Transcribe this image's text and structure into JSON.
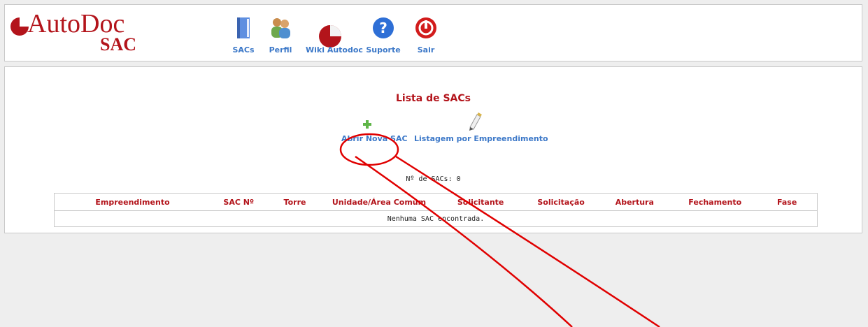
{
  "header": {
    "logo": {
      "brand": "AutoDoc",
      "sub": "SAC"
    },
    "nav": [
      {
        "label": "SACs",
        "icon": "book-icon"
      },
      {
        "label": "Perfil",
        "icon": "users-icon"
      },
      {
        "label": "Wiki Autodoc",
        "icon": "pie-chart-icon"
      },
      {
        "label": "Suporte",
        "icon": "help-icon"
      },
      {
        "label": "Sair",
        "icon": "power-icon"
      }
    ]
  },
  "main": {
    "title": "Lista de SACs",
    "actions": [
      {
        "label": "Abrir Nova SAC",
        "icon": "plus-icon"
      },
      {
        "label": "Listagem por Empreendimento",
        "icon": "edit-pencil-icon"
      }
    ],
    "count_label": "Nº de SACs: 0",
    "table": {
      "columns": [
        "Empreendimento",
        "SAC Nº",
        "Torre",
        "Unidade/Área Comum",
        "Solicitante",
        "Solicitação",
        "Abertura",
        "Fechamento",
        "Fase"
      ],
      "empty_message": "Nenhuma SAC encontrada."
    }
  },
  "colors": {
    "brand": "#b3141b",
    "link": "#3c78c8",
    "annotation": "#e00000"
  }
}
